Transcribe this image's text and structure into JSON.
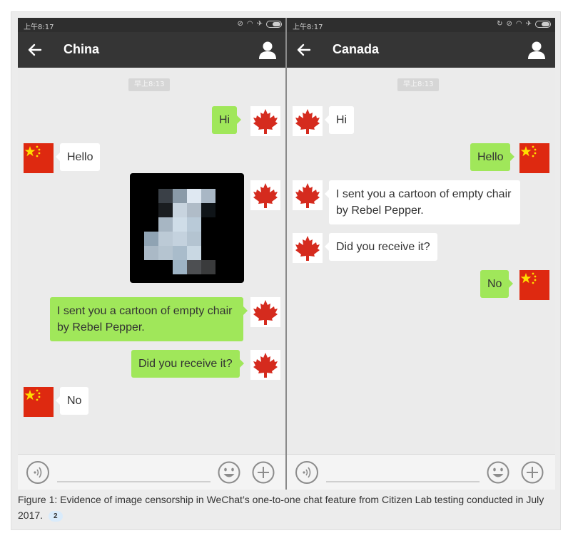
{
  "left_phone": {
    "status_time": "上午8:17",
    "title": "China",
    "timestamp": "早上8:13",
    "messages": {
      "m1": "Hi",
      "m2": "Hello",
      "m3": "I sent you a cartoon of empty chair by Rebel Pepper.",
      "m4": "Did you receive it?",
      "m5": "No"
    },
    "censored_image_label": "censored-image"
  },
  "right_phone": {
    "status_time": "上午8:17",
    "title": "Canada",
    "timestamp": "早上8:13",
    "messages": {
      "m1": "Hi",
      "m2": "Hello",
      "m3": "I sent you a cartoon of empty chair by Rebel Pepper.",
      "m4": "Did you receive it?",
      "m5": "No"
    }
  },
  "caption": {
    "text": "Figure 1: Evidence of image censorship in WeChat’s one-to-one chat feature from Citizen Lab testing conducted in July 2017.",
    "footnote": "2"
  },
  "colors": {
    "title_bar": "#353535",
    "status_bar": "#2e2e2e",
    "chat_bg": "#ebebeb",
    "sent_bubble": "#a0e75a",
    "received_bubble": "#ffffff",
    "china_red": "#de2910",
    "china_star": "#ffde00",
    "maple_red": "#d52b1e",
    "footnote_badge": "#d9ebfb"
  },
  "icons": {
    "back": "arrow-left-icon",
    "profile": "person-icon",
    "voice": "voice-icon",
    "emoji": "smiley-icon",
    "plus": "plus-icon",
    "china_flag": "china-flag-icon",
    "canada_flag": "maple-leaf-icon"
  }
}
